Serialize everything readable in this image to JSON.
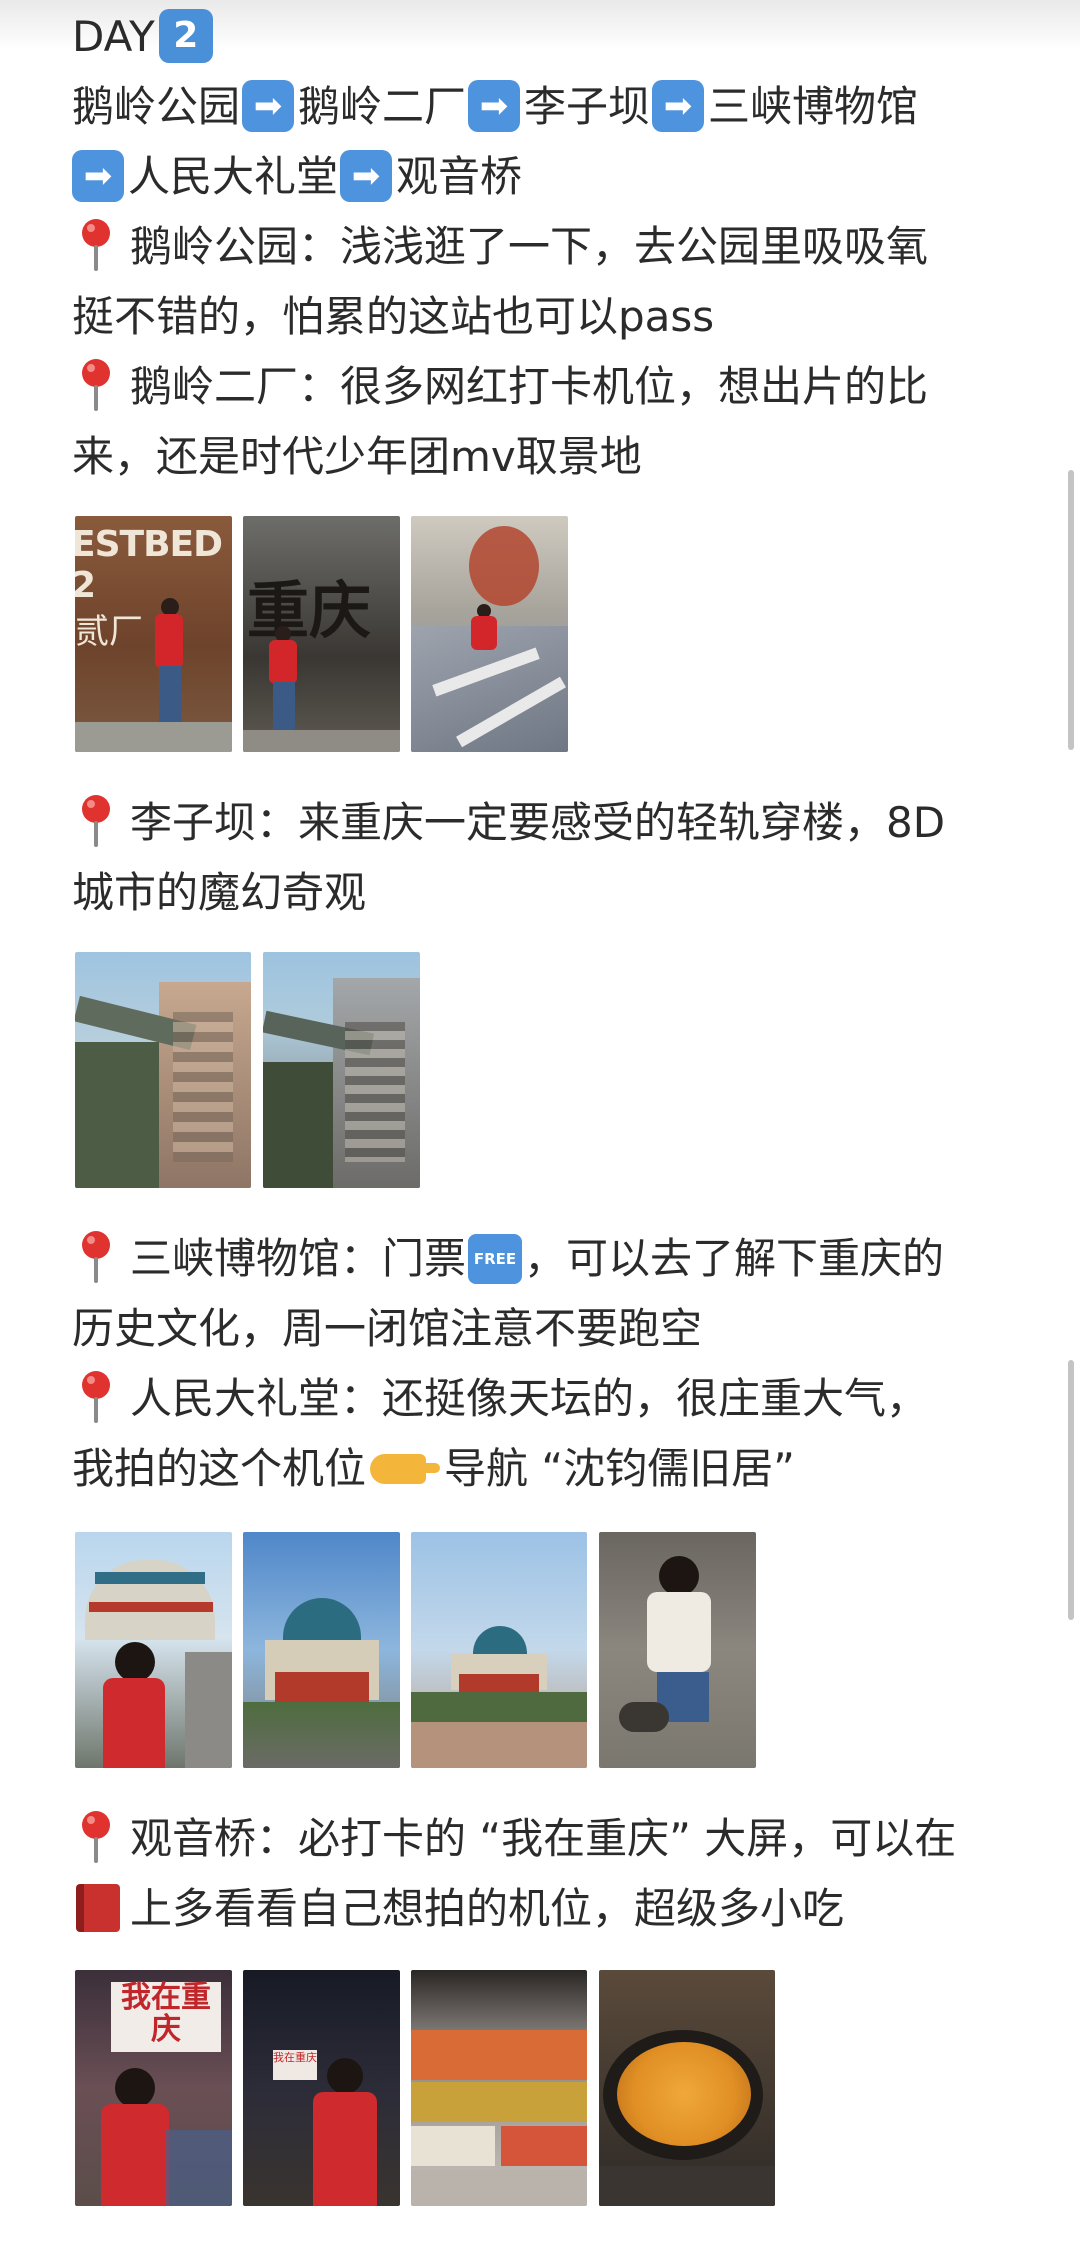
{
  "header": {
    "day_label": "DAY",
    "day_number": "2"
  },
  "route": {
    "stops": [
      "鹅岭公园",
      "鹅岭二厂",
      "李子坝",
      "三峡博物馆",
      "人民大礼堂",
      "观音桥"
    ],
    "arrow": "➡"
  },
  "spots": {
    "eling_park": {
      "line1": "鹅岭公园：浅浅逛了一下，去公园里吸吸氧",
      "line2": "挺不错的，怕累的这站也可以pass"
    },
    "eling_factory": {
      "line1": "鹅岭二厂：很多网红打卡机位，想出片的比",
      "line2": "来，还是时代少年团mv取景地"
    },
    "liziba": {
      "line1": "李子坝：来重庆一定要感受的轻轨穿楼，8D",
      "line2": "城市的魔幻奇观"
    },
    "sanxia": {
      "line1_a": "三峡博物馆：门票",
      "free_badge": "FREE",
      "line1_b": "，可以去了解下重庆的",
      "line2": "历史文化，周一闭馆注意不要跑空"
    },
    "renmin": {
      "line1": "人民大礼堂：还挺像天坛的，很庄重大气，",
      "line2_a": "我拍的这个机位",
      "line2_b": "导航 “沈钧儒旧居”"
    },
    "guanyinqiao": {
      "line1": "观音桥：必打卡的 “我在重庆” 大屏，可以在",
      "line2": "上多看看自己想拍的机位，超级多小吃"
    }
  },
  "photo_text": {
    "testbed": "ESTBED 2",
    "factory_sign": "贰厂",
    "chongqing_wall": "重庆",
    "screen_sign": "我在重庆"
  },
  "colors": {
    "text": "#2b2b2b",
    "emoji_blue": "#4e93dd",
    "pin_red": "#e0332f",
    "book_red": "#c9312f",
    "hand_yellow": "#f4b63a"
  },
  "icons": [
    "pin-icon",
    "arrow-right-icon",
    "free-icon",
    "book-icon",
    "pointing-hand-icon",
    "keycap-2-icon"
  ]
}
